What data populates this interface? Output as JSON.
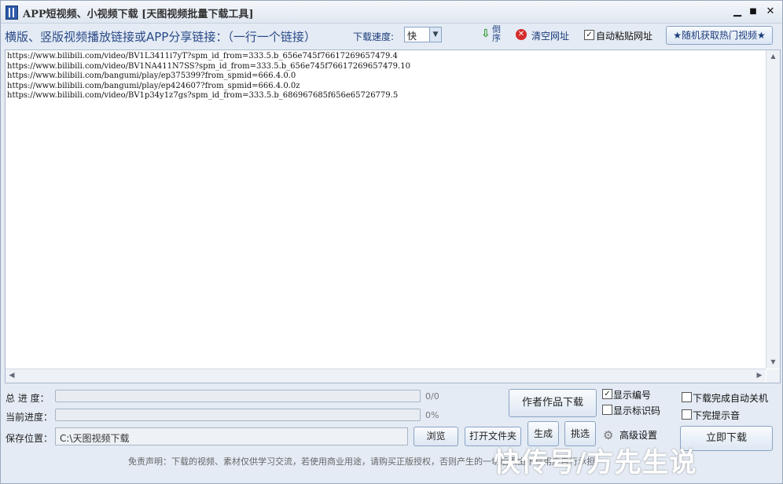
{
  "titlebar": {
    "title": "APP短视频、小视频下载 [天图视频批量下载工具]",
    "minimize": "▁",
    "maximize": "■",
    "close": "✕"
  },
  "toolbar": {
    "hint": "横版、竖版视频播放链接或APP分享链接：（一行一个链接）",
    "speed_label": "下载速度:",
    "speed_value": "快",
    "reverse_label": "倒序",
    "clear_label": "清空网址",
    "autopaste_label": "自动粘贴网址",
    "autopaste_checked": true,
    "hot_label": "★随机获取热门视频★"
  },
  "urls": [
    "https://www.bilibili.com/video/BV1L3411i7yT?spm_id_from=333.5.b_656e745f76617269657479.4",
    "https://www.bilibili.com/video/BV1NA411N7SS?spm_id_from=333.5.b_656e745f76617269657479.10",
    "https://www.bilibili.com/bangumi/play/ep375399?from_spmid=666.4.0.0",
    "https://www.bilibili.com/bangumi/play/ep424607?from_spmid=666.4.0.0z",
    "https://www.bilibili.com/video/BV1p34y1z7gs?spm_id_from=333.5.b_686967685f656e65726779.5"
  ],
  "progress": {
    "total_label": "总 进 度：",
    "total_text": "0/0",
    "total_fraction": 0,
    "current_label": "当前进度：",
    "current_text": "0%",
    "current_fraction": 0
  },
  "save": {
    "label": "保存位置：",
    "path": "C:\\天图视频下载",
    "browse": "浏览",
    "open_folder": "打开文件夹"
  },
  "actions": {
    "author_download": "作者作品下载",
    "generate": "生成",
    "pick": "挑选",
    "show_number": "显示编号",
    "show_number_checked": true,
    "show_id": "显示标识码",
    "show_id_checked": false,
    "advanced": "高级设置",
    "shutdown": "下载完成自动关机",
    "shutdown_checked": false,
    "sound": "下完提示音",
    "sound_checked": false,
    "download_now": "立即下载"
  },
  "disclaimer": "免责声明：下载的视频、素材仅供学习交流，若使用商业用途，请购买正版授权，否则产生的一切后果由下载用户自行承担",
  "watermark": "快传号/方先生说",
  "colors": {
    "accent": "#2a4a88",
    "progress_fill": "#5bb85b",
    "close_icon": "#d62b2b"
  }
}
